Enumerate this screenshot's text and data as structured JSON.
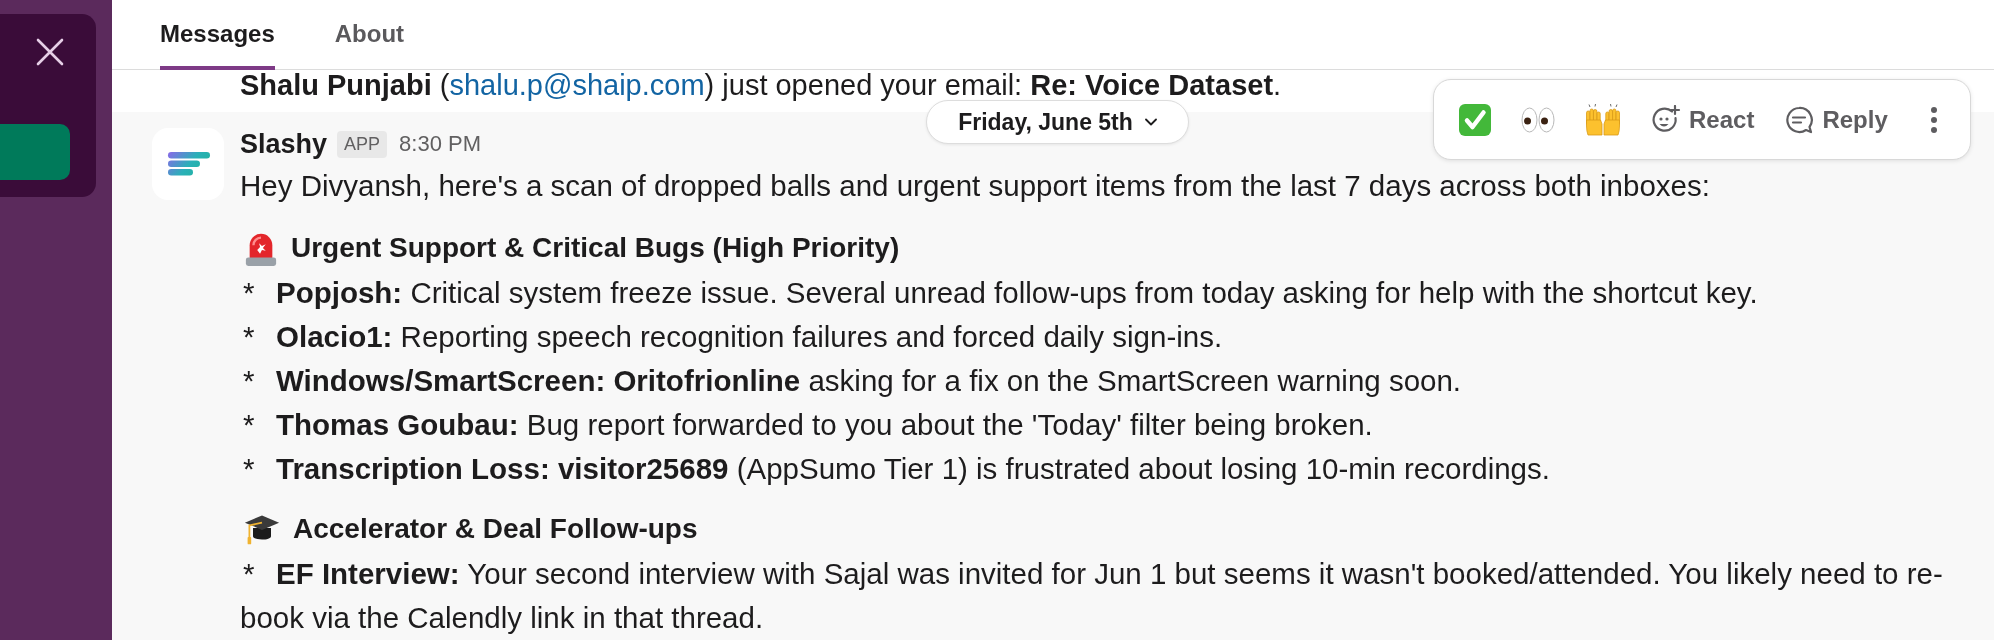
{
  "tabs": [
    {
      "label": "Messages",
      "selected": true
    },
    {
      "label": "About",
      "selected": false
    }
  ],
  "notification": {
    "before": "**Shalu Punjabi** (",
    "link": "shalu.p@shaip.com",
    "after": ") just opened your email: **Re: Voice Dataset**."
  },
  "date_divider": {
    "label": "Friday, June 5th"
  },
  "message": {
    "sender": "Slashy",
    "badge": "APP",
    "time": "8:30 PM",
    "intro": "Hey Divyansh, here's a scan of dropped balls and urgent support items from the last 7 days across both inboxes:",
    "sections": [
      {
        "title": "Urgent Support & Critical Bugs (High Priority)",
        "items": [
          {
            "marker": "*",
            "text": "**Popjosh:** Critical system freeze issue. Several unread follow-ups from today asking for help with the shortcut key."
          },
          {
            "marker": "*",
            "text": "**Olacio1:** Reporting speech recognition failures and forced daily sign-ins."
          },
          {
            "marker": "*",
            "text": "**Windows/SmartScreen: Oritofrionline** asking for a fix on the SmartScreen warning soon."
          },
          {
            "marker": "*",
            "text": "**Thomas Goubau:** Bug report forwarded to you about the 'Today' filter being broken."
          },
          {
            "marker": "*",
            "text": "**Transcription Loss: visitor25689** (AppSumo Tier 1) is frustrated about losing 10-min recordings."
          }
        ]
      },
      {
        "title": "Accelerator & Deal Follow-ups",
        "items": [
          {
            "marker": "*",
            "text": "**EF Interview:** Your second interview with Sajal was invited for Jun 1 but seems it wasn't booked/attended. You likely need to re-book via the Calendly link in that thread."
          }
        ]
      }
    ]
  },
  "hover_actions": {
    "actions": [
      {
        "label": "React"
      },
      {
        "label": "Reply"
      }
    ]
  }
}
